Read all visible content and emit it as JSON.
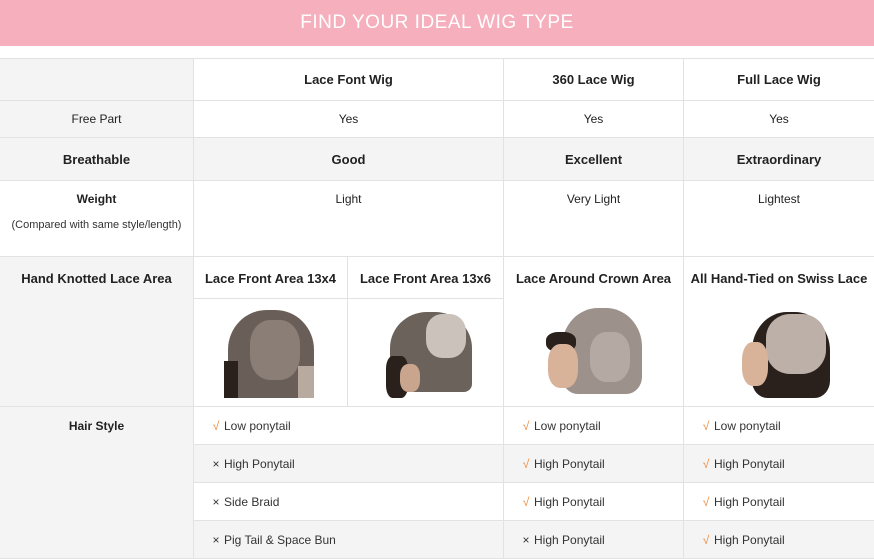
{
  "banner": {
    "title": "FIND YOUR IDEAL WIG TYPE"
  },
  "header": {
    "col1": "Lace Font Wig",
    "col2": "360 Lace Wig",
    "col3": "Full Lace Wig"
  },
  "rows": {
    "free_part": {
      "label": "Free Part",
      "values": [
        "Yes",
        "Yes",
        "Yes"
      ]
    },
    "breathable": {
      "label": "Breathable",
      "values": [
        "Good",
        "Excellent",
        "Extraordinary"
      ]
    },
    "weight": {
      "label": "Weight",
      "note": "(Compared with same style/length)",
      "values": [
        "Light",
        "Very Light",
        "Lightest"
      ]
    },
    "lace_area": {
      "label": "Hand Knotted Lace Area",
      "values": [
        "Lace Front Area 13x4",
        "Lace Front Area 13x6",
        "Lace Around Crown Area",
        "All Hand-Tied on Swiss Lace"
      ]
    },
    "hair_style": {
      "label": "Hair Style",
      "lace_front": [
        {
          "mark": "√",
          "text": "Low ponytail"
        },
        {
          "mark": "×",
          "text": "High Ponytail"
        },
        {
          "mark": "×",
          "text": "Side Braid"
        },
        {
          "mark": "×",
          "text": "Pig Tail & Space Bun"
        }
      ],
      "lace_360": [
        {
          "mark": "√",
          "text": "Low ponytail"
        },
        {
          "mark": "√",
          "text": "High Ponytail"
        },
        {
          "mark": "√",
          "text": "High Ponytail"
        },
        {
          "mark": "×",
          "text": "High Ponytail"
        }
      ],
      "full_lace": [
        {
          "mark": "√",
          "text": "Low ponytail"
        },
        {
          "mark": "√",
          "text": "High Ponytail"
        },
        {
          "mark": "√",
          "text": "High Ponytail"
        },
        {
          "mark": "√",
          "text": "High Ponytail"
        }
      ]
    }
  },
  "colors": {
    "banner": "#f6b0bd",
    "check": "#f08a3a",
    "row_gray": "#f4f4f4",
    "border": "#e2e2e2"
  }
}
